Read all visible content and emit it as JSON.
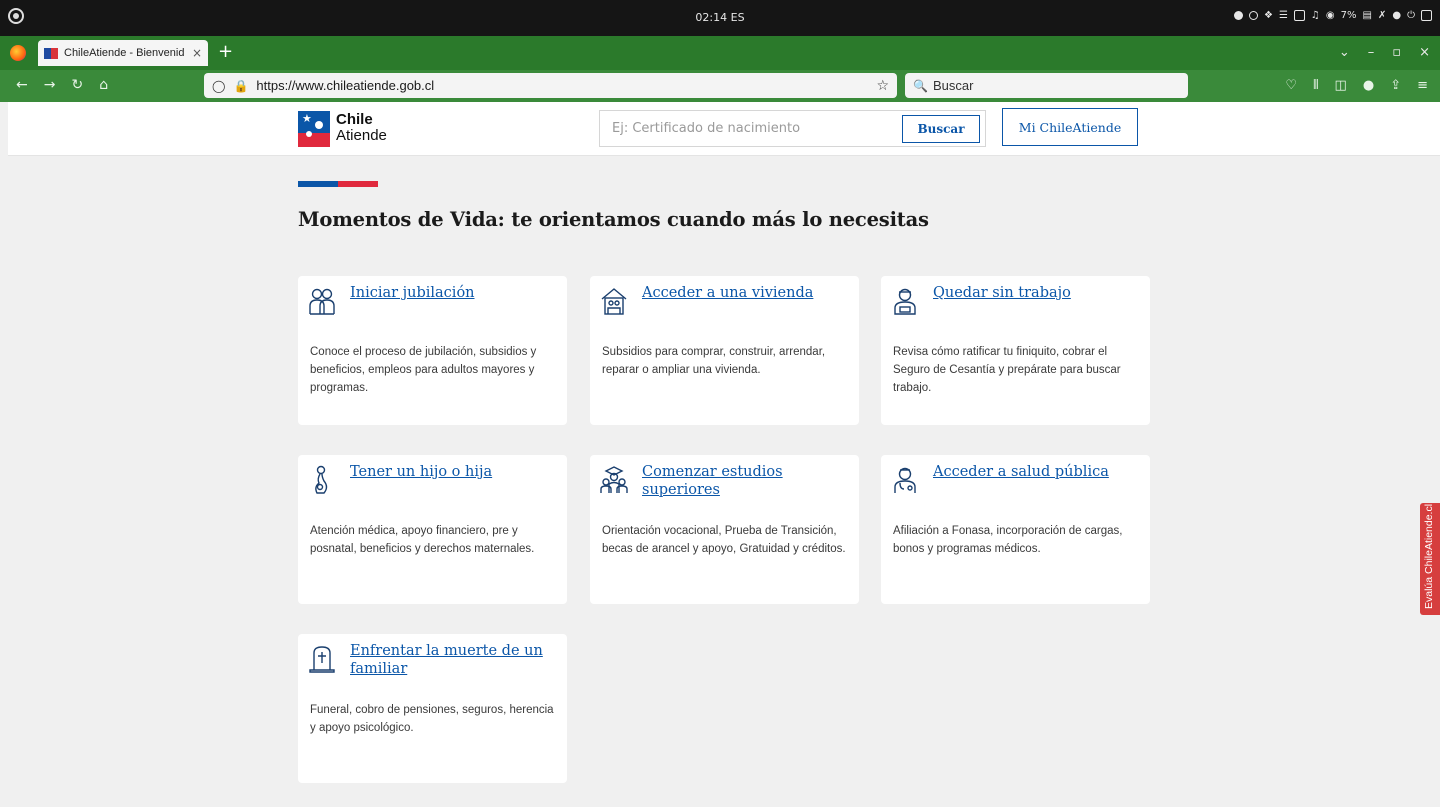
{
  "os": {
    "clock": "02:14",
    "lang": "ES",
    "battery": "7%"
  },
  "browser": {
    "tab_title": "ChileAtiende - Bienvenid",
    "tab_close": "×",
    "new_tab": "+",
    "url": "https://www.chileatiende.gob.cl",
    "search_placeholder": "Buscar",
    "window_controls": [
      "⌄",
      "–",
      "▫",
      "×"
    ]
  },
  "site": {
    "logo_line1": "Chile",
    "logo_line2": "Atiende",
    "search_placeholder": "Ej: Certificado de nacimiento",
    "search_button": "Buscar",
    "account_button": "Mi ChileAtiende",
    "brand_colors": {
      "blue": "#0b56a8",
      "red": "#e0293d"
    },
    "section_title": "Momentos de Vida: te orientamos cuando más lo necesitas",
    "cards": [
      {
        "title": "Iniciar jubilación",
        "icon": "elderly-couple-icon",
        "desc": "Conoce el proceso de jubilación, subsidios y beneficios, empleos para adultos mayores y programas."
      },
      {
        "title": "Acceder a una vivienda",
        "icon": "house-icon",
        "desc": "Subsidios para comprar, construir, arrendar, reparar o ampliar una vivienda."
      },
      {
        "title": "Quedar sin trabajo",
        "icon": "worker-icon",
        "desc": "Revisa cómo ratificar tu  finiquito, cobrar el Seguro de Cesantía y prepárate para buscar trabajo."
      },
      {
        "title": "Tener un hijo o hija",
        "icon": "pregnancy-icon",
        "desc": "Atención médica, apoyo financiero, pre y posnatal, beneficios y derechos maternales."
      },
      {
        "title": "Comenzar estudios superiores",
        "icon": "graduates-icon",
        "desc": "Orientación vocacional, Prueba de Transición, becas de arancel y apoyo, Gratuidad y créditos."
      },
      {
        "title": "Acceder a salud pública",
        "icon": "doctor-icon",
        "desc": "Afiliación a Fonasa, incorporación de cargas, bonos y programas médicos."
      },
      {
        "title": "Enfrentar la muerte de un familiar",
        "icon": "tombstone-icon",
        "desc": "Funeral, cobro de pensiones, seguros, herencia y apoyo psicológico."
      }
    ],
    "feedback_tab": "Evalúa ChileAtiende.cl"
  }
}
